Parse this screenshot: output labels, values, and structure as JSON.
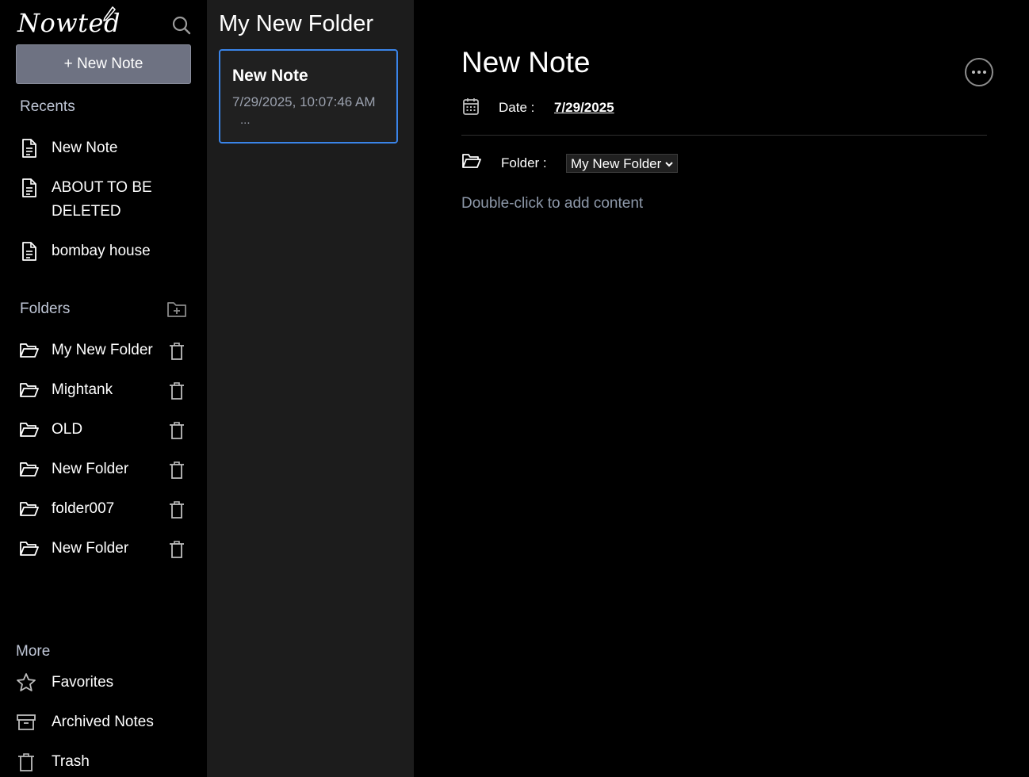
{
  "app": {
    "logo": "Nowted"
  },
  "sidebar": {
    "new_note_label": "+ New Note",
    "recents_title": "Recents",
    "recents": [
      {
        "label": "New Note"
      },
      {
        "label": "ABOUT TO BE DELETED"
      },
      {
        "label": "bombay house"
      }
    ],
    "folders_title": "Folders",
    "folders": [
      {
        "label": "My New Folder"
      },
      {
        "label": "Mightank"
      },
      {
        "label": "OLD"
      },
      {
        "label": "New Folder"
      },
      {
        "label": "folder007"
      },
      {
        "label": "New Folder"
      }
    ],
    "more_title": "More",
    "more": [
      {
        "label": "Favorites",
        "icon": "star-icon"
      },
      {
        "label": "Archived Notes",
        "icon": "archive-icon"
      },
      {
        "label": "Trash",
        "icon": "trash-icon"
      }
    ]
  },
  "note_list": {
    "folder_title": "My New Folder",
    "notes": [
      {
        "title": "New Note",
        "date": "7/29/2025, 10:07:46 AM",
        "excerpt": "..."
      }
    ]
  },
  "editor": {
    "title": "New Note",
    "date_label": "Date :",
    "date_value": "7/29/2025",
    "folder_label": "Folder :",
    "folder_value": "My New Folder",
    "placeholder": "Double-click to add content"
  },
  "colors": {
    "accent": "#3a84e8",
    "sidebar_bg": "#000000",
    "list_bg": "#1c1c1c",
    "button_bg": "#6e7282"
  }
}
